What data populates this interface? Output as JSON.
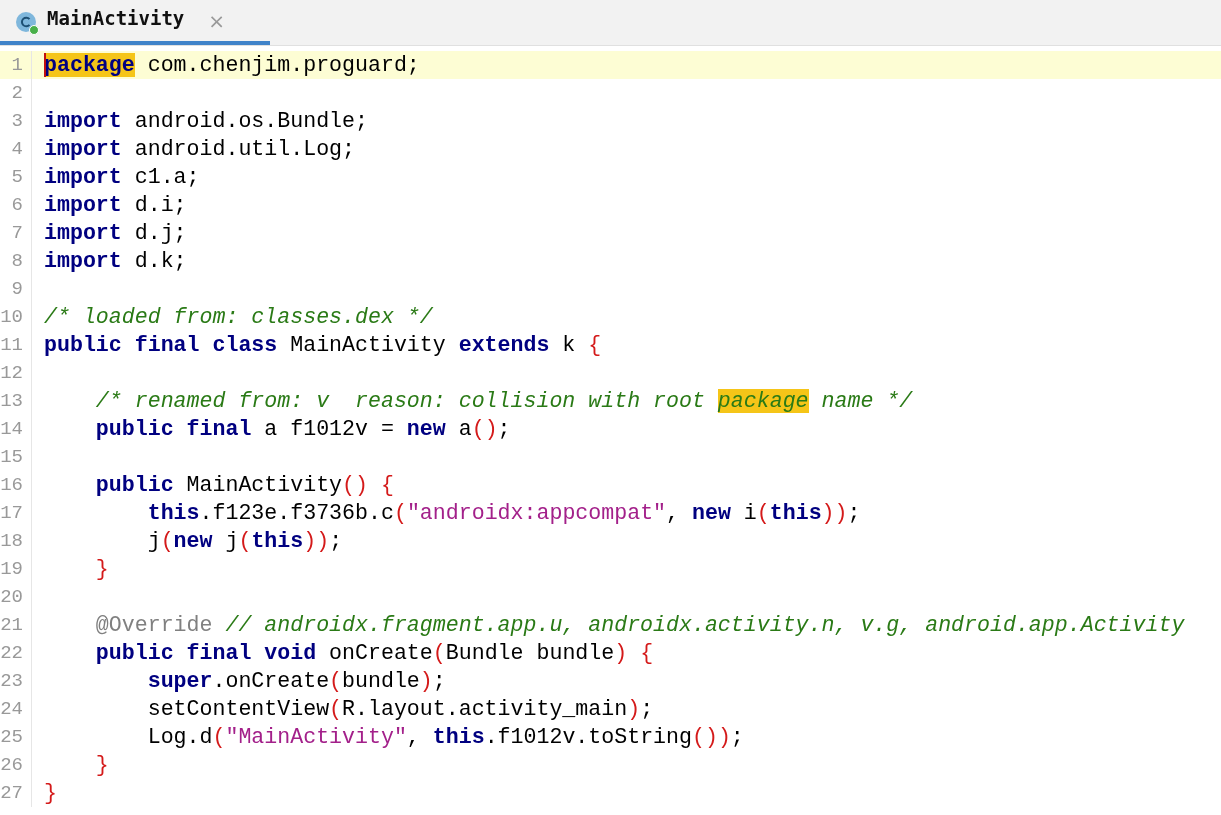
{
  "tabs": [
    {
      "title": "MainActivity",
      "selected": true,
      "close": "×"
    }
  ],
  "lines": [
    {
      "number": "1",
      "current": true,
      "tokens": [
        {
          "kind": "keyword",
          "text": "package",
          "highlighted": true
        },
        {
          "kind": "plain",
          "text": " com.chenjim.proguard;"
        }
      ]
    },
    {
      "number": "2",
      "current": false
    },
    {
      "number": "3",
      "current": false,
      "tokens": [
        {
          "kind": "keyword",
          "text": "import"
        },
        {
          "kind": "plain",
          "text": " android.os.Bundle;"
        }
      ]
    },
    {
      "number": "4",
      "current": false,
      "tokens": [
        {
          "kind": "keyword",
          "text": "import"
        },
        {
          "kind": "plain",
          "text": " android.util.Log;"
        }
      ]
    },
    {
      "number": "5",
      "current": false,
      "tokens": [
        {
          "kind": "keyword",
          "text": "import"
        },
        {
          "kind": "plain",
          "text": " c1.a;"
        }
      ]
    },
    {
      "number": "6",
      "current": false,
      "tokens": [
        {
          "kind": "keyword",
          "text": "import"
        },
        {
          "kind": "plain",
          "text": " d.i;"
        }
      ]
    },
    {
      "number": "7",
      "current": false,
      "tokens": [
        {
          "kind": "keyword",
          "text": "import"
        },
        {
          "kind": "plain",
          "text": " d.j;"
        }
      ]
    },
    {
      "number": "8",
      "current": false,
      "tokens": [
        {
          "kind": "keyword",
          "text": "import"
        },
        {
          "kind": "plain",
          "text": " d.k;"
        }
      ]
    },
    {
      "number": "9",
      "current": false
    },
    {
      "number": "10",
      "current": false,
      "tokens": [
        {
          "kind": "comment",
          "text": "/* loaded from: classes.dex */"
        }
      ]
    },
    {
      "number": "11",
      "current": false,
      "tokens": [
        {
          "kind": "keyword",
          "text": "public final class"
        },
        {
          "kind": "plain",
          "text": " MainActivity "
        },
        {
          "kind": "keyword",
          "text": "extends"
        },
        {
          "kind": "plain",
          "text": " k "
        },
        {
          "kind": "brace",
          "text": "{"
        }
      ]
    },
    {
      "number": "12",
      "current": false
    },
    {
      "number": "13",
      "current": false,
      "tokens": [
        {
          "kind": "comment",
          "text": "    /* renamed from: v  reason: collision with root "
        },
        {
          "kind": "comment",
          "text": "package",
          "highlighted": true
        },
        {
          "kind": "comment",
          "text": " name */"
        }
      ]
    },
    {
      "number": "14",
      "current": false,
      "tokens": [
        {
          "kind": "keyword",
          "text": "    public final"
        },
        {
          "kind": "plain",
          "text": " a f1012v = "
        },
        {
          "kind": "keyword",
          "text": "new"
        },
        {
          "kind": "plain",
          "text": " a"
        },
        {
          "kind": "brace",
          "text": "()"
        },
        {
          "kind": "plain",
          "text": ";"
        }
      ]
    },
    {
      "number": "15",
      "current": false
    },
    {
      "number": "16",
      "current": false,
      "tokens": [
        {
          "kind": "keyword",
          "text": "    public"
        },
        {
          "kind": "plain",
          "text": " MainActivity"
        },
        {
          "kind": "brace",
          "text": "() {"
        }
      ]
    },
    {
      "number": "17",
      "current": false,
      "tokens": [
        {
          "kind": "keyword",
          "text": "        this"
        },
        {
          "kind": "plain",
          "text": ".f123e.f3736b.c"
        },
        {
          "kind": "brace",
          "text": "("
        },
        {
          "kind": "string",
          "text": "\"androidx:appcompat\""
        },
        {
          "kind": "plain",
          "text": ", "
        },
        {
          "kind": "keyword",
          "text": "new"
        },
        {
          "kind": "plain",
          "text": " i"
        },
        {
          "kind": "brace",
          "text": "("
        },
        {
          "kind": "keyword",
          "text": "this"
        },
        {
          "kind": "brace",
          "text": "))"
        },
        {
          "kind": "plain",
          "text": ";"
        }
      ]
    },
    {
      "number": "18",
      "current": false,
      "tokens": [
        {
          "kind": "plain",
          "text": "        j"
        },
        {
          "kind": "brace",
          "text": "("
        },
        {
          "kind": "keyword",
          "text": "new"
        },
        {
          "kind": "plain",
          "text": " j"
        },
        {
          "kind": "brace",
          "text": "("
        },
        {
          "kind": "keyword",
          "text": "this"
        },
        {
          "kind": "brace",
          "text": "))"
        },
        {
          "kind": "plain",
          "text": ";"
        }
      ]
    },
    {
      "number": "19",
      "current": false,
      "tokens": [
        {
          "kind": "brace",
          "text": "    }"
        }
      ]
    },
    {
      "number": "20",
      "current": false
    },
    {
      "number": "21",
      "current": false,
      "tokens": [
        {
          "kind": "annotation",
          "text": "    @Override"
        },
        {
          "kind": "comment",
          "text": " // androidx.fragment.app.u, androidx.activity.n, v.g, android.app.Activity"
        }
      ]
    },
    {
      "number": "22",
      "current": false,
      "tokens": [
        {
          "kind": "keyword",
          "text": "    public final void"
        },
        {
          "kind": "plain",
          "text": " onCreate"
        },
        {
          "kind": "brace",
          "text": "("
        },
        {
          "kind": "plain",
          "text": "Bundle bundle"
        },
        {
          "kind": "brace",
          "text": ") {"
        }
      ]
    },
    {
      "number": "23",
      "current": false,
      "tokens": [
        {
          "kind": "keyword",
          "text": "        super"
        },
        {
          "kind": "plain",
          "text": ".onCreate"
        },
        {
          "kind": "brace",
          "text": "("
        },
        {
          "kind": "plain",
          "text": "bundle"
        },
        {
          "kind": "brace",
          "text": ")"
        },
        {
          "kind": "plain",
          "text": ";"
        }
      ]
    },
    {
      "number": "24",
      "current": false,
      "tokens": [
        {
          "kind": "plain",
          "text": "        setContentView"
        },
        {
          "kind": "brace",
          "text": "("
        },
        {
          "kind": "plain",
          "text": "R.layout.activity_main"
        },
        {
          "kind": "brace",
          "text": ")"
        },
        {
          "kind": "plain",
          "text": ";"
        }
      ]
    },
    {
      "number": "25",
      "current": false,
      "tokens": [
        {
          "kind": "plain",
          "text": "        Log.d"
        },
        {
          "kind": "brace",
          "text": "("
        },
        {
          "kind": "string",
          "text": "\"MainActivity\""
        },
        {
          "kind": "plain",
          "text": ", "
        },
        {
          "kind": "keyword",
          "text": "this"
        },
        {
          "kind": "plain",
          "text": ".f1012v.toString"
        },
        {
          "kind": "brace",
          "text": "())"
        },
        {
          "kind": "plain",
          "text": ";"
        }
      ]
    },
    {
      "number": "26",
      "current": false,
      "tokens": [
        {
          "kind": "brace",
          "text": "    }"
        }
      ]
    },
    {
      "number": "27",
      "current": false,
      "tokens": [
        {
          "kind": "brace",
          "text": "}"
        }
      ]
    }
  ]
}
